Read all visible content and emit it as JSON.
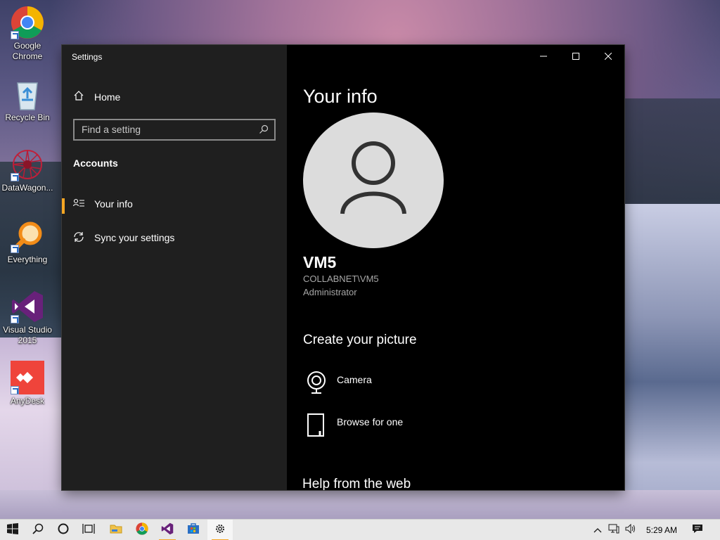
{
  "desktop": {
    "icons": [
      {
        "label": "Google Chrome",
        "line1": "Google",
        "line2": "Chrome",
        "icon": "chrome-icon"
      },
      {
        "label": "Recycle Bin",
        "line1": "Recycle Bin",
        "line2": "",
        "icon": "recycle-bin-icon"
      },
      {
        "label": "DataWagon...",
        "line1": "DataWagon...",
        "line2": "",
        "icon": "datawagon-icon"
      },
      {
        "label": "Everything",
        "line1": "Everything",
        "line2": "",
        "icon": "everything-search-icon"
      },
      {
        "label": "Visual Studio 2015",
        "line1": "Visual Studio",
        "line2": "2015",
        "icon": "visual-studio-icon"
      },
      {
        "label": "AnyDesk",
        "line1": "AnyDesk",
        "line2": "",
        "icon": "anydesk-icon"
      }
    ]
  },
  "window": {
    "title": "Settings",
    "controls": {
      "minimize": "minimize-icon",
      "maximize": "maximize-icon",
      "close": "close-icon"
    }
  },
  "nav": {
    "home_label": "Home",
    "search_placeholder": "Find a setting",
    "section_title": "Accounts",
    "items": [
      {
        "label": "Your info",
        "icon": "person-list-icon",
        "selected": true
      },
      {
        "label": "Sync your settings",
        "icon": "sync-icon",
        "selected": false
      }
    ],
    "accent_color": "#f5a623"
  },
  "content": {
    "page_title": "Your info",
    "user": {
      "name": "VM5",
      "account": "COLLABNET\\VM5",
      "role": "Administrator"
    },
    "create_picture_heading": "Create your picture",
    "options": [
      {
        "label": "Camera",
        "icon": "camera-icon"
      },
      {
        "label": "Browse for one",
        "icon": "browse-file-icon"
      }
    ],
    "help_heading": "Help from the web"
  },
  "taskbar": {
    "items": [
      {
        "name": "start-button",
        "icon": "windows-logo-icon"
      },
      {
        "name": "search-button",
        "icon": "search-icon"
      },
      {
        "name": "cortana-button",
        "icon": "cortana-circle-icon"
      },
      {
        "name": "task-view-button",
        "icon": "task-view-icon"
      },
      {
        "name": "file-explorer-button",
        "icon": "folder-icon"
      },
      {
        "name": "chrome-taskbar-button",
        "icon": "chrome-icon"
      },
      {
        "name": "visual-studio-taskbar-button",
        "icon": "visual-studio-icon"
      },
      {
        "name": "store-taskbar-button",
        "icon": "store-icon"
      },
      {
        "name": "settings-taskbar-button",
        "icon": "gear-icon",
        "active": true
      }
    ],
    "tray": {
      "chevron": "chevron-up-icon",
      "network": "network-icon",
      "volume": "volume-icon",
      "time": "5:29 AM",
      "notifications": "notification-icon"
    }
  }
}
